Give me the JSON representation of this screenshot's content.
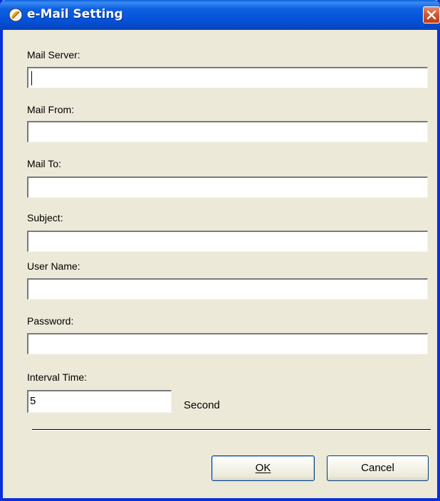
{
  "window": {
    "title": "e-Mail Setting"
  },
  "fields": [
    {
      "label": "Mail Server:",
      "value": ""
    },
    {
      "label": "Mail From:",
      "value": ""
    },
    {
      "label": "Mail To:",
      "value": ""
    },
    {
      "label": "Subject:",
      "value": ""
    },
    {
      "label": "User Name:",
      "value": ""
    },
    {
      "label": "Password:",
      "value": ""
    }
  ],
  "interval": {
    "label": "Interval Time:",
    "value": "5",
    "unit": "Second"
  },
  "buttons": {
    "ok": "OK",
    "cancel": "Cancel"
  },
  "colors": {
    "titlebar": "#0451d8",
    "window_bg": "#ece9d8",
    "close": "#d4542d"
  },
  "icons": {
    "app": "app-logo-icon",
    "close": "close-icon"
  }
}
